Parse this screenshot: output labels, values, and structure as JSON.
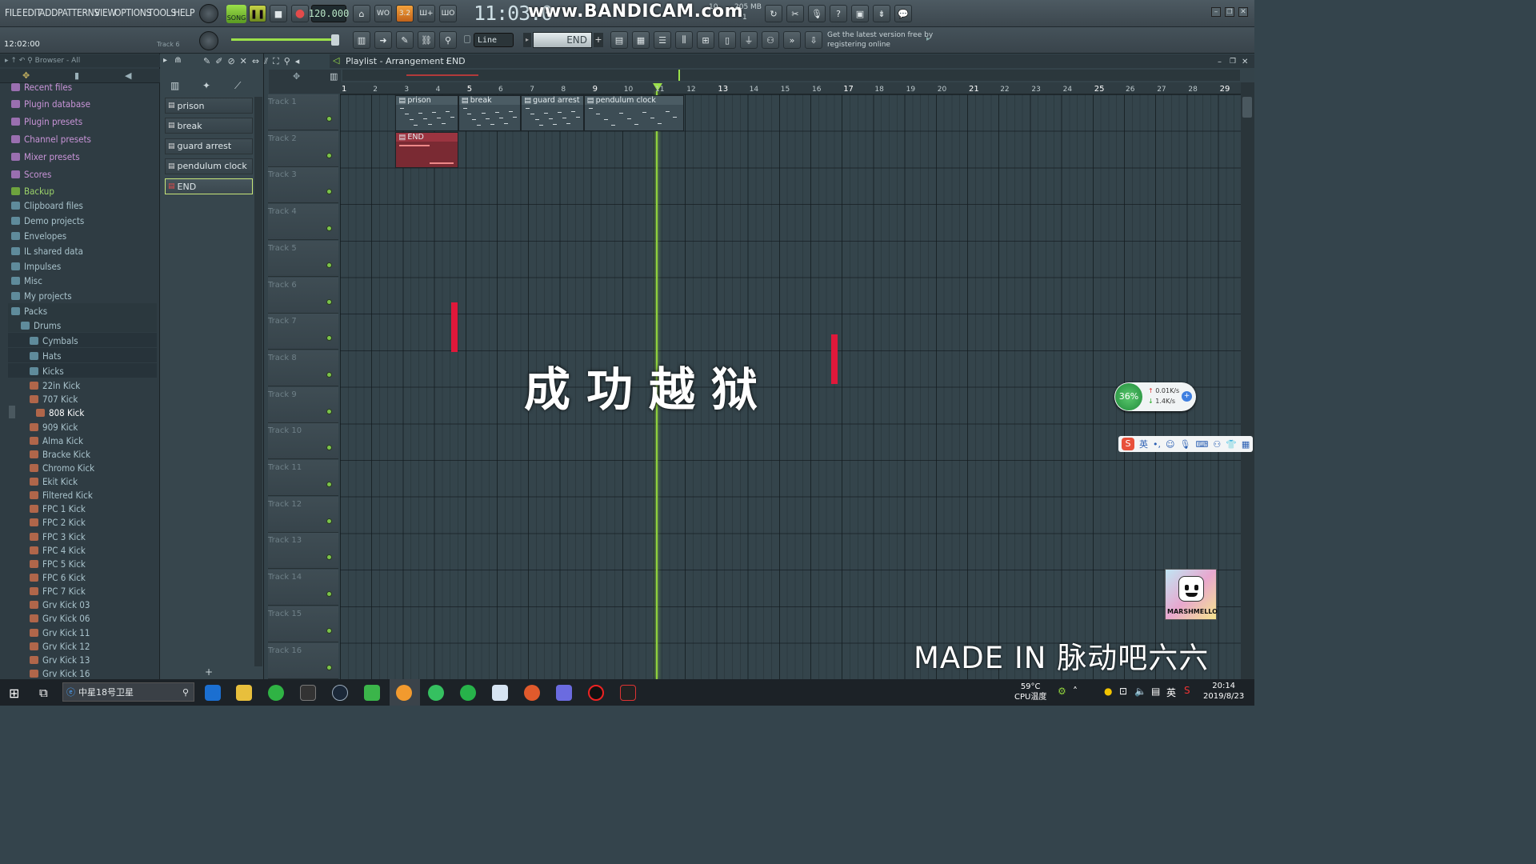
{
  "menu": [
    "FILE",
    "EDIT",
    "ADD",
    "PATTERNS",
    "VIEW",
    "OPTIONS",
    "TOOLS",
    "HELP"
  ],
  "song_mode": "SONG",
  "tempo": "120.000",
  "clock": "11:03:0",
  "watermark": "www.BANDICAM.com",
  "memory": "205 MB",
  "memory_sub": "1",
  "cpu_small": "10",
  "time_position": "12:02:00",
  "track_hint": "Track 6",
  "snap_mode": "Line",
  "pattern_selector": "END",
  "update_notice": {
    "line1": "Get the latest version free by",
    "line2": "registering online"
  },
  "browser": {
    "header": "Browser - All",
    "items": [
      {
        "label": "Recent files",
        "depth": 0,
        "color": "#c994d8"
      },
      {
        "label": "Plugin database",
        "depth": 0,
        "color": "#c994d8"
      },
      {
        "label": "Plugin presets",
        "depth": 0,
        "color": "#c994d8"
      },
      {
        "label": "Channel presets",
        "depth": 0,
        "color": "#c994d8"
      },
      {
        "label": "Mixer presets",
        "depth": 0,
        "color": "#c994d8"
      },
      {
        "label": "Scores",
        "depth": 0,
        "color": "#c994d8"
      },
      {
        "label": "Backup",
        "depth": 0,
        "color": "#9cd36a"
      },
      {
        "label": "Clipboard files",
        "depth": 0,
        "color": "#a9c3cc"
      },
      {
        "label": "Demo projects",
        "depth": 0,
        "color": "#a9c3cc"
      },
      {
        "label": "Envelopes",
        "depth": 0,
        "color": "#a9c3cc"
      },
      {
        "label": "IL shared data",
        "depth": 0,
        "color": "#a9c3cc"
      },
      {
        "label": "Impulses",
        "depth": 0,
        "color": "#a9c3cc"
      },
      {
        "label": "Misc",
        "depth": 0,
        "color": "#a9c3cc"
      },
      {
        "label": "My projects",
        "depth": 0,
        "color": "#a9c3cc"
      },
      {
        "label": "Packs",
        "depth": 0,
        "color": "#a9c3cc"
      },
      {
        "label": "Drums",
        "depth": 1,
        "color": "#a9c3cc"
      },
      {
        "label": "Cymbals",
        "depth": 2,
        "color": "#a9c3cc"
      },
      {
        "label": "Hats",
        "depth": 2,
        "color": "#a9c3cc"
      },
      {
        "label": "Kicks",
        "depth": 2,
        "color": "#a9c3cc"
      },
      {
        "label": "22in Kick",
        "depth": 3,
        "color": "#a9c3cc"
      },
      {
        "label": "707 Kick",
        "depth": 3,
        "color": "#a9c3cc"
      },
      {
        "label": "808 Kick",
        "depth": 3,
        "color": "#ffffff"
      },
      {
        "label": "909 Kick",
        "depth": 3,
        "color": "#a9c3cc"
      },
      {
        "label": "Alma Kick",
        "depth": 3,
        "color": "#a9c3cc"
      },
      {
        "label": "Bracke Kick",
        "depth": 3,
        "color": "#a9c3cc"
      },
      {
        "label": "Chromo Kick",
        "depth": 3,
        "color": "#a9c3cc"
      },
      {
        "label": "Ekit Kick",
        "depth": 3,
        "color": "#a9c3cc"
      },
      {
        "label": "Filtered Kick",
        "depth": 3,
        "color": "#a9c3cc"
      },
      {
        "label": "FPC 1 Kick",
        "depth": 3,
        "color": "#a9c3cc"
      },
      {
        "label": "FPC 2 Kick",
        "depth": 3,
        "color": "#a9c3cc"
      },
      {
        "label": "FPC 3 Kick",
        "depth": 3,
        "color": "#a9c3cc"
      },
      {
        "label": "FPC 4 Kick",
        "depth": 3,
        "color": "#a9c3cc"
      },
      {
        "label": "FPC 5 Kick",
        "depth": 3,
        "color": "#a9c3cc"
      },
      {
        "label": "FPC 6 Kick",
        "depth": 3,
        "color": "#a9c3cc"
      },
      {
        "label": "FPC 7 Kick",
        "depth": 3,
        "color": "#a9c3cc"
      },
      {
        "label": "Grv Kick 03",
        "depth": 3,
        "color": "#a9c3cc"
      },
      {
        "label": "Grv Kick 06",
        "depth": 3,
        "color": "#a9c3cc"
      },
      {
        "label": "Grv Kick 11",
        "depth": 3,
        "color": "#a9c3cc"
      },
      {
        "label": "Grv Kick 12",
        "depth": 3,
        "color": "#a9c3cc"
      },
      {
        "label": "Grv Kick 13",
        "depth": 3,
        "color": "#a9c3cc"
      },
      {
        "label": "Grv Kick 16",
        "depth": 3,
        "color": "#a9c3cc"
      }
    ]
  },
  "patterns": [
    "prison",
    "break",
    "guard arrest",
    "pendulum clock",
    "END"
  ],
  "playlist": {
    "title": "Playlist - Arrangement",
    "current": "END",
    "tracks": [
      "Track 1",
      "Track 2",
      "Track 3",
      "Track 4",
      "Track 5",
      "Track 6",
      "Track 7",
      "Track 8",
      "Track 9",
      "Track 10",
      "Track 11",
      "Track 12",
      "Track 13",
      "Track 14",
      "Track 15",
      "Track 16"
    ],
    "bars": [
      "1",
      "2",
      "3",
      "4",
      "5",
      "6",
      "7",
      "8",
      "9",
      "10",
      "11",
      "12",
      "13",
      "14",
      "15",
      "16",
      "17",
      "18",
      "19",
      "20",
      "21",
      "22",
      "23",
      "24",
      "25",
      "26",
      "27",
      "28",
      "29"
    ],
    "clips": [
      {
        "label": "prison",
        "track": 1,
        "start": 3,
        "length": 2,
        "color": "#3d4d55"
      },
      {
        "label": "break",
        "track": 1,
        "start": 5,
        "length": 2,
        "color": "#3d4d55"
      },
      {
        "label": "guard arrest",
        "track": 1,
        "start": 7,
        "length": 2,
        "color": "#3d4d55"
      },
      {
        "label": "pendulum clock",
        "track": 1,
        "start": 9,
        "length": 3.2,
        "color": "#3d4d55"
      },
      {
        "label": "END",
        "track": 2,
        "start": 3,
        "length": 2,
        "color": "#7a2a33"
      }
    ],
    "playhead_bar": 11
  },
  "overlay": {
    "title": "成功越狱",
    "credit": "MADE IN 脉动吧六六",
    "logo_text": "MARSHMELLO"
  },
  "netmeter": {
    "percent": "36%",
    "up": "0.01K/s",
    "down": "1.4K/s"
  },
  "ime": {
    "lang": "英"
  },
  "taskbar": {
    "search": "中星18号卫星",
    "temp": "59°C",
    "temp_label": "CPU温度",
    "time": "20:14",
    "date": "2019/8/23",
    "ime": "英"
  }
}
